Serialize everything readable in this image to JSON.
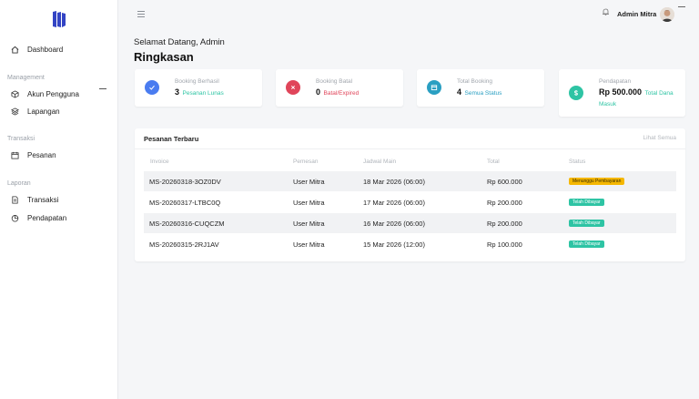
{
  "sidebar": {
    "dashboard": "Dashboard",
    "section_management": "Management",
    "akun": "Akun Pengguna",
    "lapangan": "Lapangan",
    "section_transaksi": "Transaksi",
    "pesanan": "Pesanan",
    "section_laporan": "Laporan",
    "transaksi": "Transaksi",
    "pendapatan": "Pendapatan"
  },
  "header": {
    "admin_name": "Admin Mitra"
  },
  "page": {
    "welcome": "Selamat Datang, Admin",
    "title": "Ringkasan"
  },
  "stats": [
    {
      "label": "Booking Berhasil",
      "value": "3",
      "sub": "Pesanan Lunas",
      "color": "#2ec4a4",
      "icon_bg": "#4a7cf0",
      "icon": "check-icon"
    },
    {
      "label": "Booking Batal",
      "value": "0",
      "sub": "Batal/Expired",
      "color": "#e0455a",
      "icon_bg": "#e0455a",
      "icon": "x-icon"
    },
    {
      "label": "Total Booking",
      "value": "4",
      "sub": "Semua Status",
      "color": "#2a9fc2",
      "icon_bg": "#2a9fc2",
      "icon": "calendar-icon"
    },
    {
      "label": "Pendapatan",
      "value": "Rp 500.000",
      "sub": "Total Dana Masuk",
      "color": "#2ec4a4",
      "icon_bg": "#2ec4a4",
      "icon": "dollar-icon"
    }
  ],
  "orders": {
    "title": "Pesanan Terbaru",
    "see_all": "Lihat Semua",
    "columns": [
      "Invoice",
      "Pemesan",
      "Jadwal Main",
      "Total",
      "Status"
    ],
    "rows": [
      {
        "invoice": "MS-20260318-3OZ0DV",
        "customer": "User Mitra",
        "schedule": "18 Mar 2026 (06:00)",
        "total": "Rp 600.000",
        "status": "Menunggu Pembayaran",
        "status_type": "wait"
      },
      {
        "invoice": "MS-20260317-LTBC0Q",
        "customer": "User Mitra",
        "schedule": "17 Mar 2026 (06:00)",
        "total": "Rp 200.000",
        "status": "Telah Dibayar",
        "status_type": "paid"
      },
      {
        "invoice": "MS-20260316-CUQCZM",
        "customer": "User Mitra",
        "schedule": "16 Mar 2026 (06:00)",
        "total": "Rp 200.000",
        "status": "Telah Dibayar",
        "status_type": "paid"
      },
      {
        "invoice": "MS-20260315-2RJ1AV",
        "customer": "User Mitra",
        "schedule": "15 Mar 2026 (12:00)",
        "total": "Rp 100.000",
        "status": "Telah Dibayar",
        "status_type": "paid"
      }
    ]
  }
}
